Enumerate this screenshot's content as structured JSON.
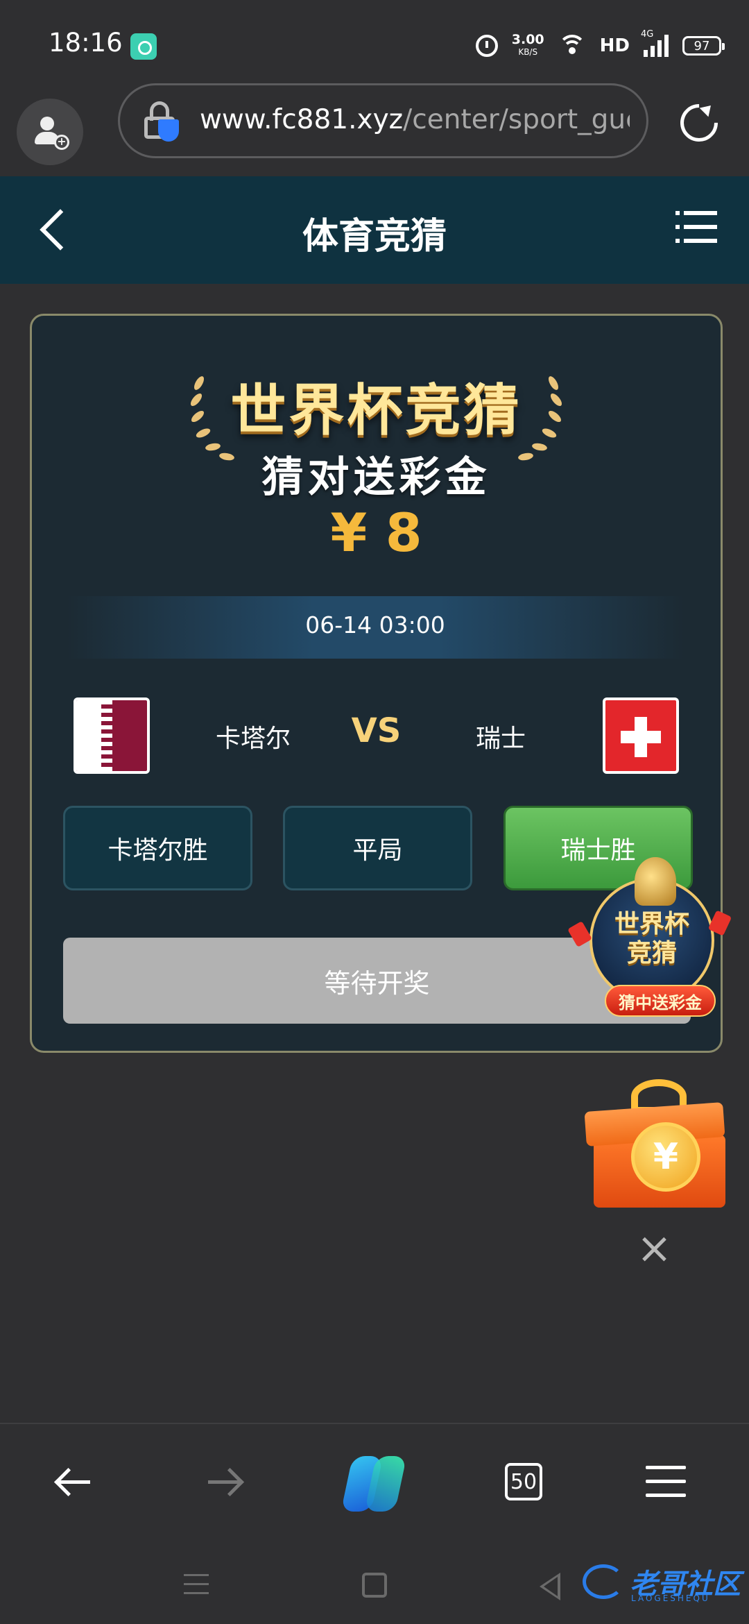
{
  "status_bar": {
    "time": "18:16",
    "net_speed": "3.00",
    "net_speed_unit": "KB/S",
    "hd_label": "HD",
    "network_label": "4G",
    "battery": "97"
  },
  "browser": {
    "url_host": "www.fc881.xyz",
    "url_path": "/center/sport_gue",
    "tabs_count": "50"
  },
  "header": {
    "title": "体育竞猜"
  },
  "card": {
    "banner_title": "世界杯竞猜",
    "banner_subtitle": "猜对送彩金",
    "prize": "¥ 8",
    "match_time": "06-14 03:00",
    "home_team": "卡塔尔",
    "vs": "VS",
    "away_team": "瑞士",
    "options": [
      {
        "label": "卡塔尔胜"
      },
      {
        "label": "平局"
      },
      {
        "label": "瑞士胜"
      }
    ],
    "selected_option": "瑞士胜",
    "status_button": "等待开奖"
  },
  "floating_badge": {
    "title_line1": "世界杯",
    "title_line2": "竞猜",
    "tag": "猜中送彩金"
  },
  "gift": {
    "coin_symbol": "¥"
  },
  "watermark": {
    "text": "老哥社区",
    "sub": "LAOGESHEQU"
  },
  "colors": {
    "header_bg": "#0f3240",
    "card_bg": "#1c2a33",
    "prize_color": "#f5b93c",
    "selected_option": "#4eae48",
    "wait_button": "#b2b2b2"
  }
}
